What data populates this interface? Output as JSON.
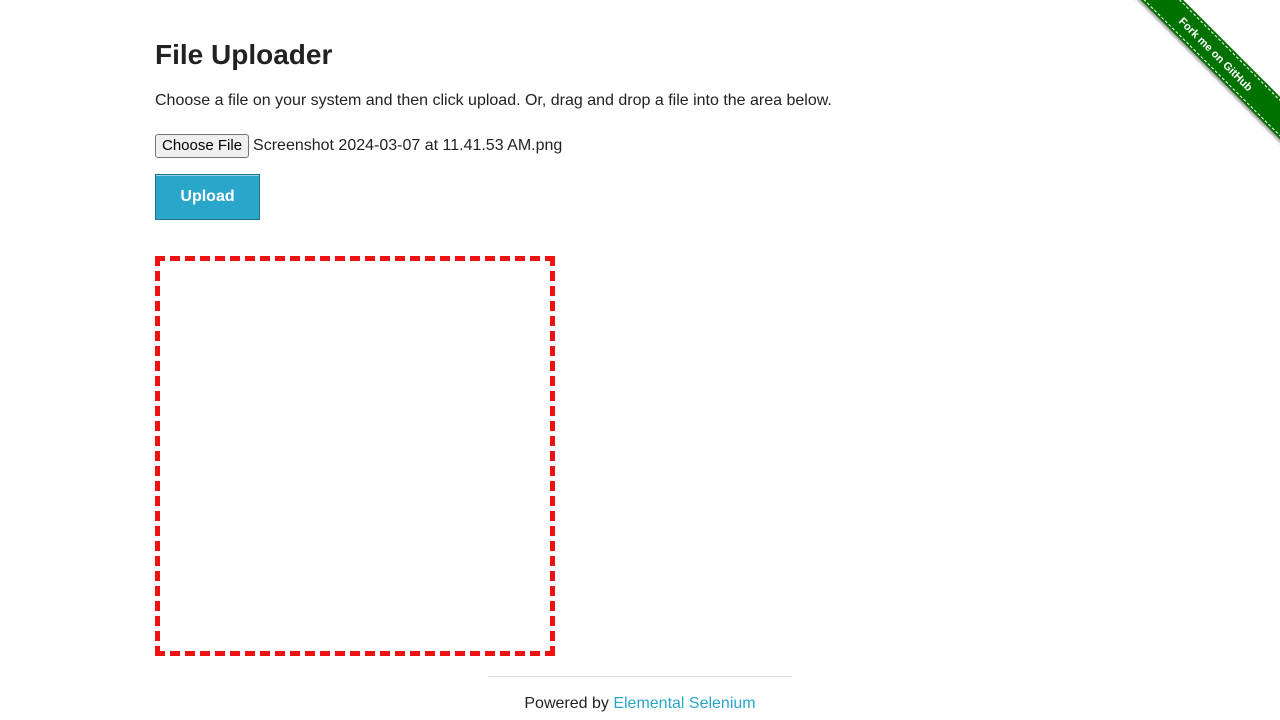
{
  "page": {
    "title": "File Uploader",
    "instructions": "Choose a file on your system and then click upload. Or, drag and drop a file into the area below."
  },
  "file_input": {
    "button_label": "Choose File",
    "selected_file": "Screenshot 2024-03-07 at 11.41.53 AM.png"
  },
  "upload_button": {
    "label": "Upload"
  },
  "drop_area": {
    "border_color": "#ee1111",
    "border_style": "dashed"
  },
  "footer": {
    "prefix": "Powered by",
    "link_text": "Elemental Selenium",
    "link_color": "#2ba6cb"
  },
  "ribbon": {
    "label": "Fork me on GitHub",
    "color": "#007200"
  },
  "colors": {
    "accent": "#2ba6cb",
    "text": "#222222"
  }
}
